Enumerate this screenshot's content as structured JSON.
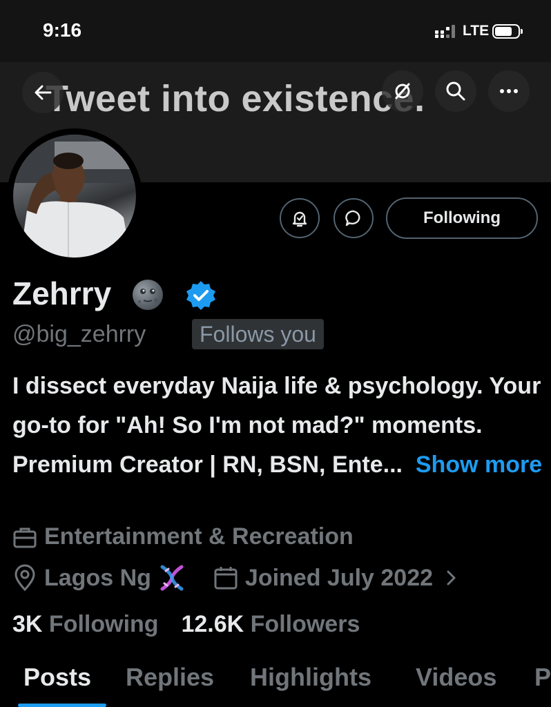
{
  "status_bar": {
    "time": "9:16",
    "network": "LTE"
  },
  "banner": {
    "text": "Tweet into existence."
  },
  "profile": {
    "display_name": "Zehrry",
    "handle": "@big_zehrry",
    "follows_you": "Follows you",
    "following_button": "Following",
    "bio": "I dissect everyday Naija life & psychology. Your go-to for \"Ah! So I'm not mad?\" moments. Premium Creator | RN, BSN, Ente...",
    "show_more": "Show more",
    "category": "Entertainment & Recreation",
    "location": "Lagos Ng",
    "joined": "Joined July 2022",
    "following_count": "3K",
    "following_label": "Following",
    "followers_count": "12.6K",
    "followers_label": "Followers"
  },
  "tabs": [
    {
      "label": "Posts"
    },
    {
      "label": "Replies"
    },
    {
      "label": "Highlights"
    },
    {
      "label": "Videos"
    },
    {
      "label": "P"
    }
  ],
  "colors": {
    "accent": "#1d9bf0",
    "muted": "#71767b",
    "text": "#e7e9ea",
    "background": "#000000"
  },
  "icons": [
    "back-arrow-icon",
    "no-notify-icon",
    "search-icon",
    "more-icon",
    "bell-icon",
    "message-icon",
    "verified-badge-icon",
    "briefcase-icon",
    "location-pin-icon",
    "calendar-icon",
    "chevron-right-icon",
    "dna-emoji-icon",
    "moon-emoji-icon"
  ]
}
